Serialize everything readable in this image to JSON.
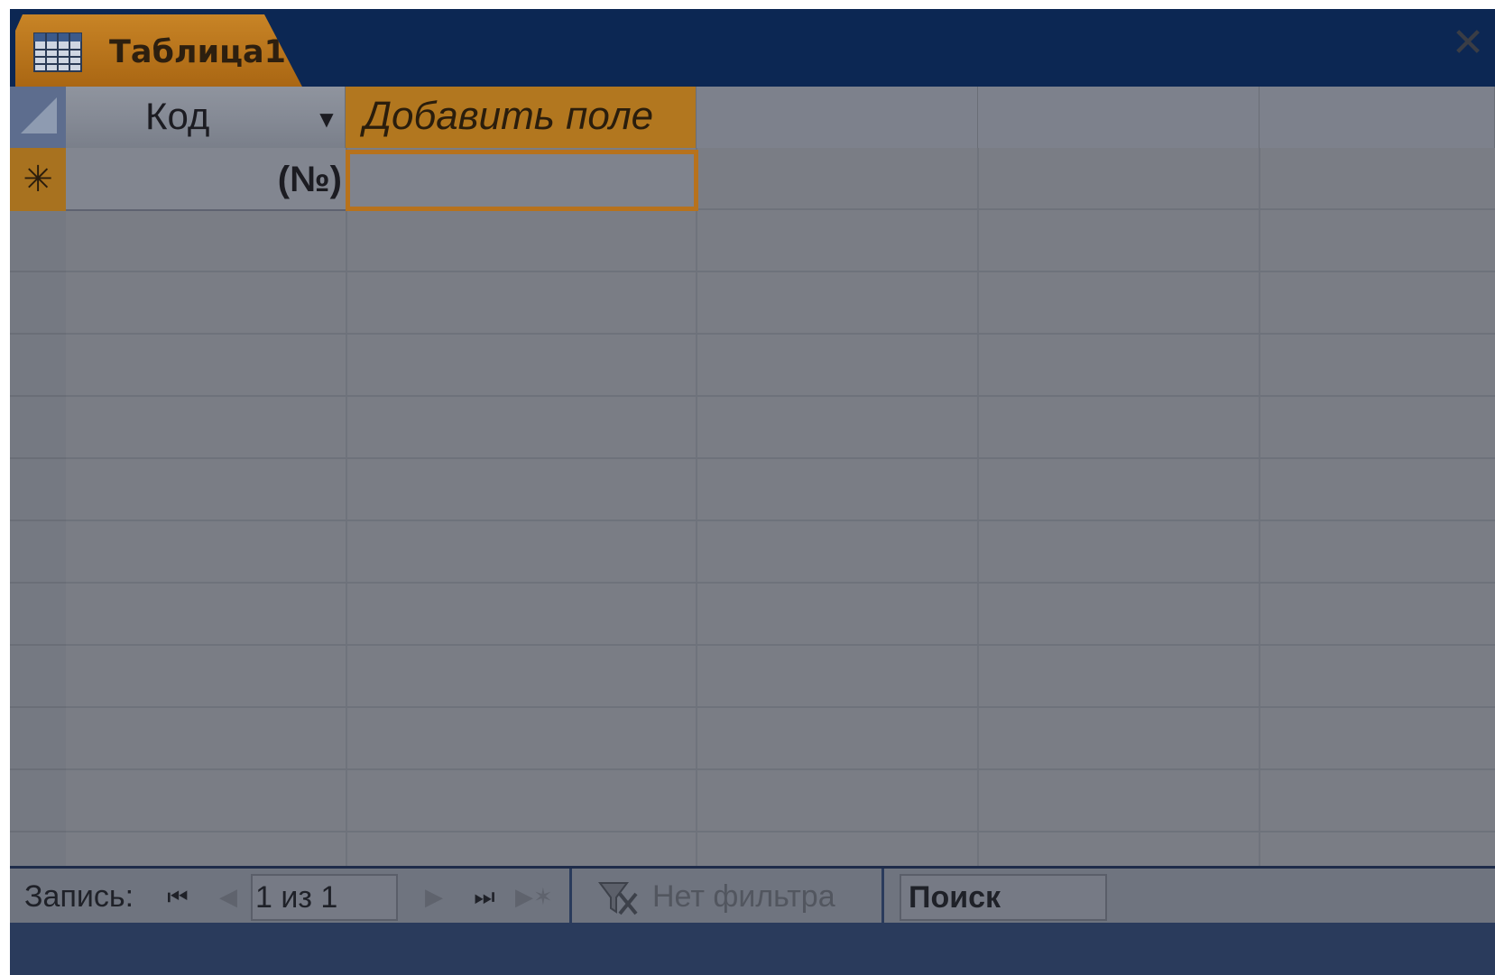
{
  "tab": {
    "title": "Таблица1",
    "icon": "datasheet-grid-icon"
  },
  "window": {
    "close_icon": "close-icon",
    "close_glyph": "✕"
  },
  "table": {
    "columns": [
      {
        "label": "Код",
        "has_dropdown": true,
        "dropdown_glyph": "▼"
      },
      {
        "label": "Добавить поле",
        "selected": true
      }
    ],
    "new_row": {
      "selector_glyph": "✳",
      "kod_value": "(№)",
      "add_field_value": ""
    }
  },
  "statusbar": {
    "record_label": "Запись:",
    "nav": {
      "first": "⏮",
      "prev": "◀",
      "next": "▶",
      "last": "⏭",
      "new": "▶✶"
    },
    "record_value": "1 из 1",
    "filter_icon": "no-filter-icon",
    "filter_label": "Нет фильтра",
    "search_value": "Поиск"
  },
  "colors": {
    "title_bar": "#0c2753",
    "accent_orange": "#b2771f",
    "grid_bg": "#7a7d85"
  }
}
